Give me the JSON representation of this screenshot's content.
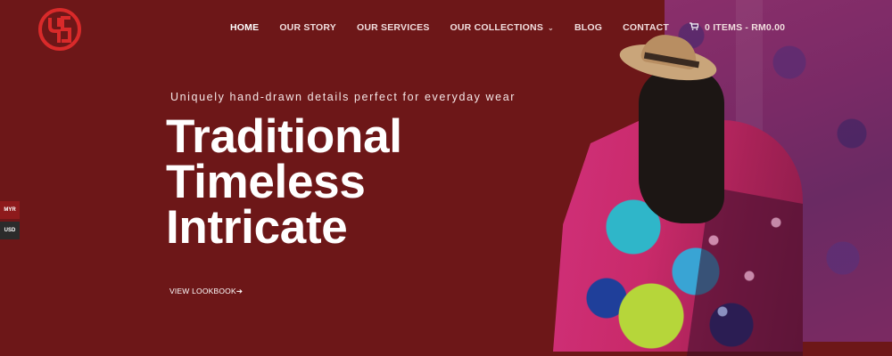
{
  "brand": {
    "logo_icon": "ys-monogram-icon",
    "logo_color": "#d92a2a"
  },
  "nav": {
    "items": [
      {
        "label": "HOME",
        "active": true
      },
      {
        "label": "OUR STORY"
      },
      {
        "label": "OUR SERVICES"
      },
      {
        "label": "OUR COLLECTIONS",
        "dropdown": true
      },
      {
        "label": "BLOG"
      },
      {
        "label": "CONTACT"
      }
    ],
    "cart_label": "0 ITEMS - RM0.00",
    "cart_icon": "cart-icon"
  },
  "hero": {
    "tagline": "Uniquely hand-drawn details perfect for everyday wear",
    "headline": [
      "Traditional",
      "Timeless",
      "Intricate"
    ],
    "cta_label": "VIEW LOOKBOOK"
  },
  "currency": {
    "options": [
      "MYR",
      "USD"
    ],
    "selected": "MYR"
  },
  "colors": {
    "background": "#6d1718",
    "accent": "#d92a2a",
    "text": "#ffffff"
  }
}
